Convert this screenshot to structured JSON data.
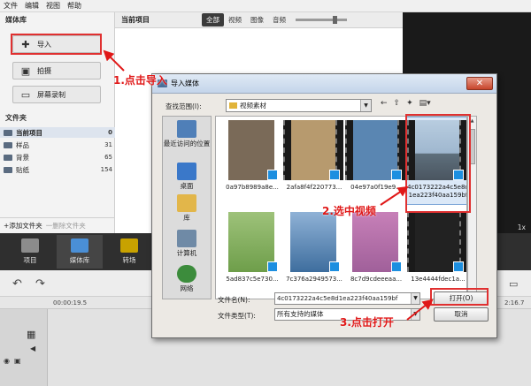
{
  "menu": [
    "文件",
    "编辑",
    "视图",
    "帮助"
  ],
  "media_panel": {
    "title": "媒体库",
    "import_label": "导入",
    "record_label": "拍摄",
    "screen_record_label": "屏幕录制"
  },
  "folders": {
    "title": "文件夹",
    "items": [
      {
        "name": "当前项目",
        "count": "0"
      },
      {
        "name": "样品",
        "count": "31"
      },
      {
        "name": "背景",
        "count": "65"
      },
      {
        "name": "贴纸",
        "count": "154"
      }
    ],
    "add_label": "+添加文件夹",
    "delete_label": "一删除文件夹"
  },
  "content_header": {
    "title": "当前项目",
    "filters": [
      "全部",
      "视频",
      "图像",
      "音频"
    ]
  },
  "preview": {
    "speed": "1x"
  },
  "mode_tabs": [
    {
      "label": "项目",
      "color": "#8c8c8c"
    },
    {
      "label": "媒体库",
      "color": "#4a8fd6"
    },
    {
      "label": "转场",
      "color": "#c8a200"
    }
  ],
  "ruler": {
    "time_start": "00:00:19.5",
    "time_end": "2:16.7"
  },
  "dialog": {
    "title": "导入媒体",
    "look_in_label": "查找范围(I):",
    "look_in_value": "视频素材",
    "places": [
      {
        "label": "最近访问的位置",
        "icon": "recent-places-icon",
        "color": "#4f7fb8"
      },
      {
        "label": "桌面",
        "icon": "desktop-icon",
        "color": "#3a78c9"
      },
      {
        "label": "库",
        "icon": "library-icon",
        "color": "#e2b64a"
      },
      {
        "label": "计算机",
        "icon": "computer-icon",
        "color": "#6f8aa6"
      },
      {
        "label": "网络",
        "icon": "network-icon",
        "color": "#3c8c3c"
      }
    ],
    "files": [
      {
        "name": "0a97b8989a8e...",
        "color": "#7a6a58",
        "film": false
      },
      {
        "name": "2afa8f4f220773...",
        "color": "#b79a6e",
        "film": true
      },
      {
        "name": "04e97a0f19e9...",
        "color": "#5a86b2",
        "film": true
      },
      {
        "name": "4c0173222a4c5e8d1ea223f40aa159bf",
        "color": "#7f9ab5",
        "film": true,
        "selected": true
      },
      {
        "name": "5ad837c5e730...",
        "color": "#6e9e4a",
        "film": false
      },
      {
        "name": "7c376a2949573...",
        "color": "#3e6e9e",
        "film": false
      },
      {
        "name": "8c7d9cdeeeaa...",
        "color": "#a0609a",
        "film": false
      },
      {
        "name": "13e4444fdec1a...",
        "color": "#222222",
        "film": true
      }
    ],
    "file_name_label": "文件名(N):",
    "file_name_value": "4c0173222a4c5e8d1ea223f40aa159bf",
    "file_type_label": "文件类型(T):",
    "file_type_value": "所有支持的媒体",
    "open_label": "打开(O)",
    "cancel_label": "取消"
  },
  "annotations": {
    "step1": "1.点击导入",
    "step2": "2.选中视频",
    "step3": "3.点击打开",
    "color": "#e01818"
  }
}
